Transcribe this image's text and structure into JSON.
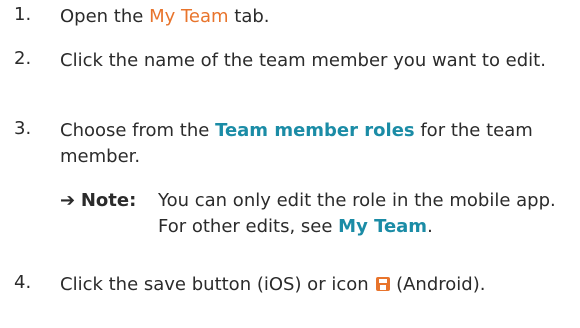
{
  "steps": [
    {
      "number": "1.",
      "pre": "Open the ",
      "link": "My Team",
      "post": " tab."
    },
    {
      "number": "2.",
      "text": "Click the name of the team member you want to edit."
    },
    {
      "number": "3.",
      "pre": "Choose from the ",
      "link": "Team member roles",
      "post": " for the team member."
    },
    {
      "number": "4.",
      "pre": "Click the save button (iOS) or icon ",
      "icon": "save-icon",
      "post": " (Android)."
    }
  ],
  "note": {
    "arrow": "➔",
    "label": "Note:",
    "pre": "You can only edit the role in the mobile app. For other edits, see ",
    "link": "My Team",
    "post": "."
  },
  "colors": {
    "text": "#2b2b2b",
    "link_orange": "#e8742c",
    "link_teal": "#1b8ca6",
    "icon": "#e8742c"
  }
}
